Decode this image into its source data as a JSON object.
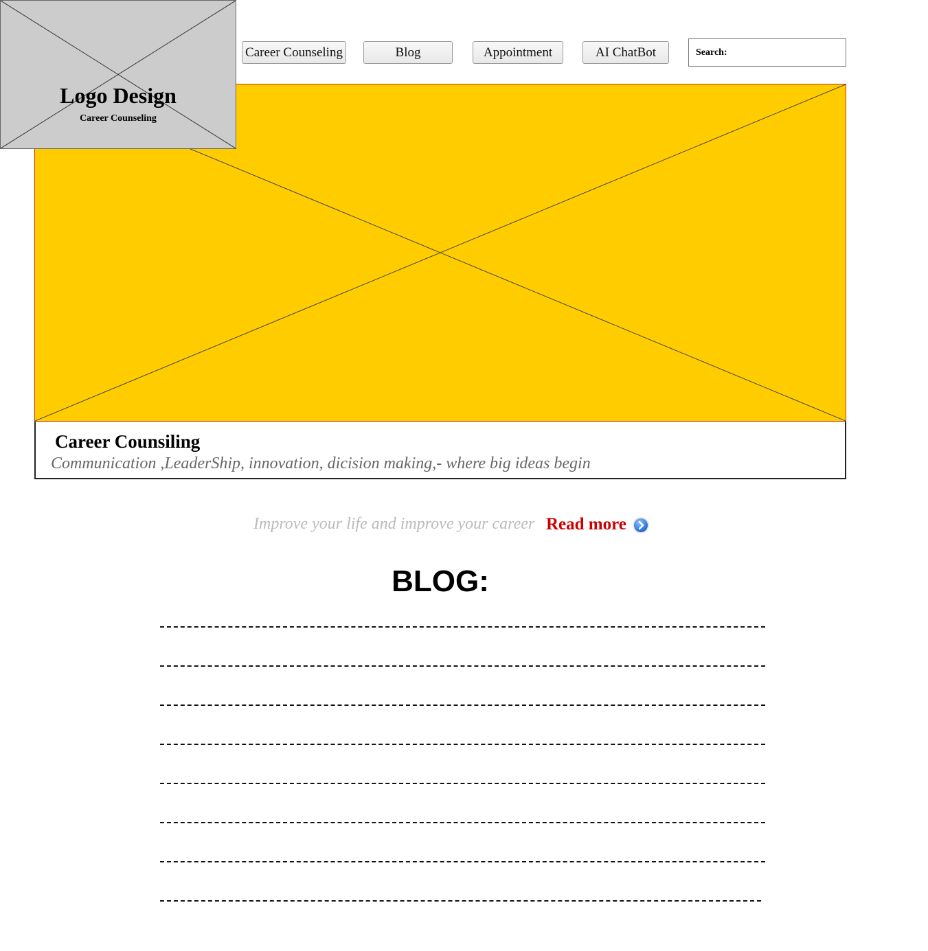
{
  "logo": {
    "title": "Logo Design",
    "subtitle": "Career Counseling"
  },
  "nav": {
    "items": [
      {
        "label": "Career Counseling"
      },
      {
        "label": "Blog"
      },
      {
        "label": "Appointment"
      },
      {
        "label": "AI ChatBot"
      }
    ],
    "search_label": "Search:",
    "search_value": ""
  },
  "hero": {
    "image_color": "#ffcc00",
    "title": "Career Counsiling",
    "subtitle": "Communication ,LeaderShip, innovation, dicision making,- where big ideas begin"
  },
  "promo": {
    "tagline": "Improve your life and improve your career",
    "read_more": "Read more",
    "icon": "chevron-right-circle-icon"
  },
  "blog": {
    "heading": "BLOG:",
    "line_count": 8
  },
  "colors": {
    "accent_red": "#cc0000",
    "hero_yellow": "#ffcc00",
    "placeholder_gray": "#cccccc"
  }
}
